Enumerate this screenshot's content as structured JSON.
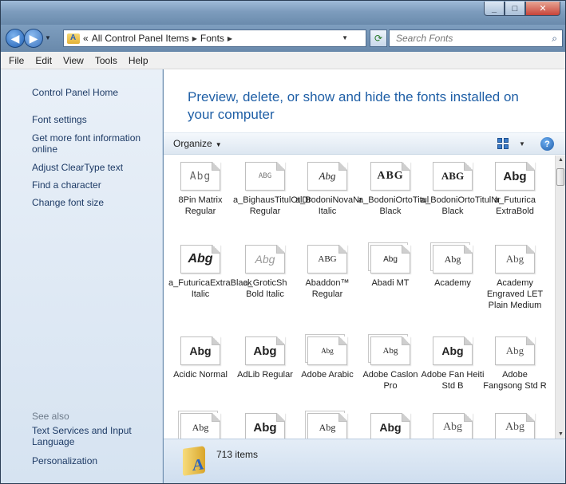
{
  "window": {
    "controls": [
      "_",
      "□",
      "✕"
    ]
  },
  "address_bar": {
    "overflow": "«",
    "crumbs": [
      "All Control Panel Items",
      "Fonts"
    ],
    "search_placeholder": "Search Fonts"
  },
  "menu": [
    "File",
    "Edit",
    "View",
    "Tools",
    "Help"
  ],
  "sidebar": {
    "links": [
      "Control Panel Home",
      "Font settings",
      "Get more font information online",
      "Adjust ClearType text",
      "Find a character",
      "Change font size"
    ],
    "see_also_label": "See also",
    "see_also": [
      "Text Services and Input Language",
      "Personalization"
    ]
  },
  "main": {
    "heading": "Preview, delete, or show and hide the fonts installed on your computer",
    "organize_label": "Organize",
    "item_count": "713 items"
  },
  "fonts": [
    {
      "name": "8Pin Matrix Regular",
      "sample": "Abg",
      "stack": false
    },
    {
      "name": "a_BighausTitulOtlDr Regular",
      "sample": "ABG",
      "stack": false
    },
    {
      "name": "a_BodoniNovaNr Italic",
      "sample": "Abg",
      "stack": false
    },
    {
      "name": "a_BodoniOrtoTitul Black",
      "sample": "ABG",
      "stack": false
    },
    {
      "name": "a_BodoniOrtoTitulNr Black",
      "sample": "ABG",
      "stack": false
    },
    {
      "name": "a_Futurica ExtraBold",
      "sample": "Abg",
      "stack": false
    },
    {
      "name": "a_FuturicaExtraBlack Italic",
      "sample": "Abg",
      "stack": false
    },
    {
      "name": "a_GroticSh Bold Italic",
      "sample": "Abg",
      "stack": false
    },
    {
      "name": "Abaddon™ Regular",
      "sample": "ABG",
      "stack": false
    },
    {
      "name": "Abadi MT",
      "sample": "Abg",
      "stack": true
    },
    {
      "name": "Academy",
      "sample": "Abg",
      "stack": true
    },
    {
      "name": "Academy Engraved LET Plain Medium",
      "sample": "Abg",
      "stack": false
    },
    {
      "name": "Acidic Normal",
      "sample": "Abg",
      "stack": false
    },
    {
      "name": "AdLib Regular",
      "sample": "Abg",
      "stack": false
    },
    {
      "name": "Adobe Arabic",
      "sample": "Abg",
      "stack": true
    },
    {
      "name": "Adobe Caslon Pro",
      "sample": "Abg",
      "stack": true
    },
    {
      "name": "Adobe Fan Heiti Std B",
      "sample": "Abg",
      "stack": false
    },
    {
      "name": "Adobe Fangsong Std R",
      "sample": "Abg",
      "stack": false
    },
    {
      "name": "",
      "sample": "Abg",
      "stack": true
    },
    {
      "name": "",
      "sample": "Abg",
      "stack": false
    },
    {
      "name": "",
      "sample": "Abg",
      "stack": true
    },
    {
      "name": "",
      "sample": "Abg",
      "stack": false
    },
    {
      "name": "",
      "sample": "Abg",
      "stack": false
    },
    {
      "name": "",
      "sample": "Abg",
      "stack": false
    }
  ]
}
